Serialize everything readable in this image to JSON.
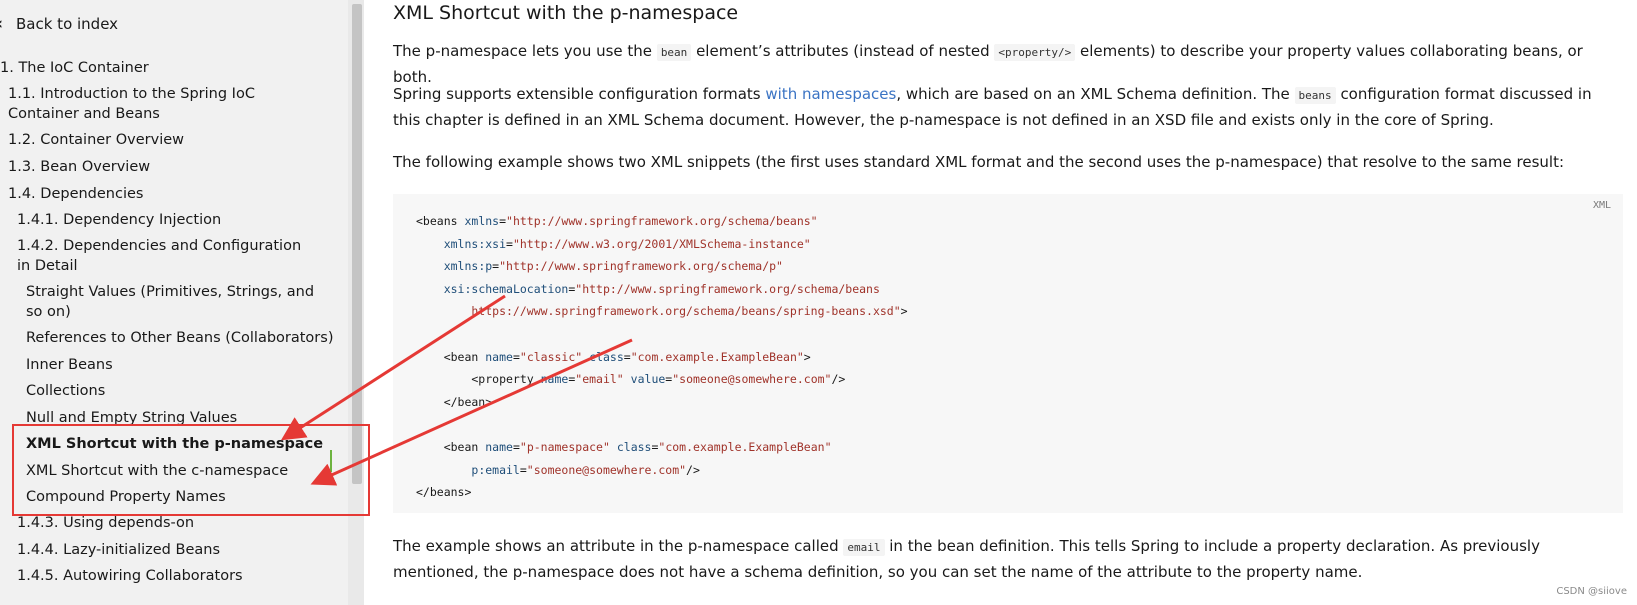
{
  "sidebar": {
    "back_label": "Back to index",
    "toc": [
      {
        "label": "1. The IoC Container"
      },
      {
        "label": "1.1. Introduction to the Spring IoC Container and Beans"
      },
      {
        "label": "1.2. Container Overview"
      },
      {
        "label": "1.3. Bean Overview"
      },
      {
        "label": "1.4. Dependencies"
      },
      {
        "label": "1.4.1. Dependency Injection"
      },
      {
        "label": "1.4.2. Dependencies and Configuration in Detail"
      },
      {
        "label": "Straight Values (Primitives, Strings, and so on)"
      },
      {
        "label": "References to Other Beans (Collaborators)"
      },
      {
        "label": "Inner Beans"
      },
      {
        "label": "Collections"
      },
      {
        "label": "Null and Empty String Values"
      },
      {
        "label": "XML Shortcut with the p-namespace",
        "active": true
      },
      {
        "label": "XML Shortcut with the c-namespace"
      },
      {
        "label": "Compound Property Names"
      },
      {
        "label": "1.4.3. Using depends-on"
      },
      {
        "label": "1.4.4. Lazy-initialized Beans"
      },
      {
        "label": "1.4.5. Autowiring Collaborators"
      }
    ]
  },
  "main": {
    "title": "XML Shortcut with the p-namespace",
    "p1": {
      "a": "The p-namespace lets you use the ",
      "code1": "bean",
      "b": " element’s attributes (instead of nested ",
      "code2": "<property/>",
      "c": " elements) to describe your property values collaborating beans, or both."
    },
    "p2": {
      "a": "Spring supports extensible configuration formats ",
      "link": "with namespaces",
      "b": ", which are based on an XML Schema definition. The ",
      "code1": "beans",
      "c": " configuration format discussed in this chapter is defined in an XML Schema document. However, the p-namespace is not defined in an XSD file and exists only in the core of Spring."
    },
    "p3": "The following example shows two XML snippets (the first uses standard XML format and the second uses the p-namespace) that resolve to the same result:",
    "code": {
      "lang": "XML",
      "lines": [
        "<beans xmlns=\"http://www.springframework.org/schema/beans\"",
        "    xmlns:xsi=\"http://www.w3.org/2001/XMLSchema-instance\"",
        "    xmlns:p=\"http://www.springframework.org/schema/p\"",
        "    xsi:schemaLocation=\"http://www.springframework.org/schema/beans",
        "        https://www.springframework.org/schema/beans/spring-beans.xsd\">",
        "",
        "    <bean name=\"classic\" class=\"com.example.ExampleBean\">",
        "        <property name=\"email\" value=\"someone@somewhere.com\"/>",
        "    </bean>",
        "",
        "    <bean name=\"p-namespace\" class=\"com.example.ExampleBean\"",
        "        p:email=\"someone@somewhere.com\"/>",
        "</beans>"
      ]
    },
    "p4": {
      "a": "The example shows an attribute in the p-namespace called ",
      "code1": "email",
      "b": " in the bean definition. This tells Spring to include a property declaration. As previously mentioned, the p-namespace does not have a schema definition, so you can set the name of the attribute to the property name."
    }
  },
  "watermark": "CSDN @siiove",
  "colors": {
    "accent_green": "#6db33f",
    "annotation_red": "#e53935",
    "link_blue": "#3b74c4"
  }
}
